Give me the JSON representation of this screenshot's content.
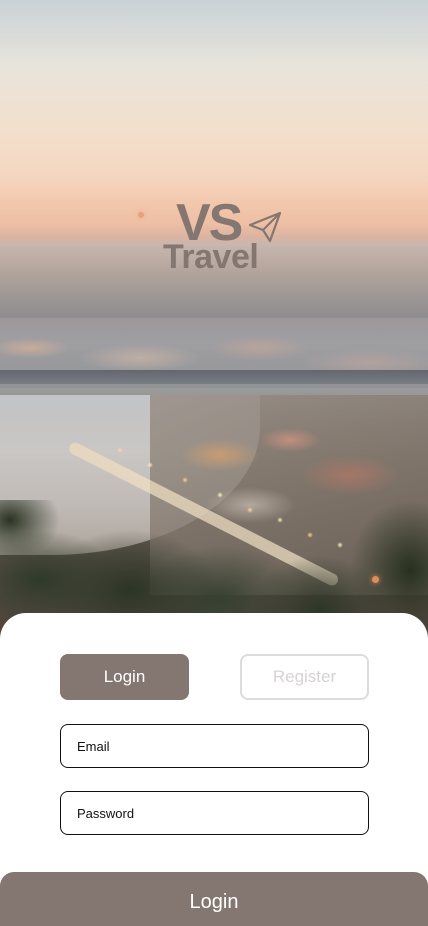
{
  "brand": {
    "logo_line1": "VS",
    "logo_line2": "Travel",
    "color": "#847670"
  },
  "tabs": {
    "login_label": "Login",
    "register_label": "Register"
  },
  "form": {
    "email_placeholder": "Email",
    "password_placeholder": "Password",
    "email_value": "",
    "password_value": ""
  },
  "submit": {
    "label": "Login"
  },
  "colors": {
    "accent": "#847670",
    "card": "#ffffff",
    "register_text": "#d6d3d2",
    "field_border": "#111111"
  },
  "icons": {
    "logo_icon": "paper-plane-icon"
  }
}
